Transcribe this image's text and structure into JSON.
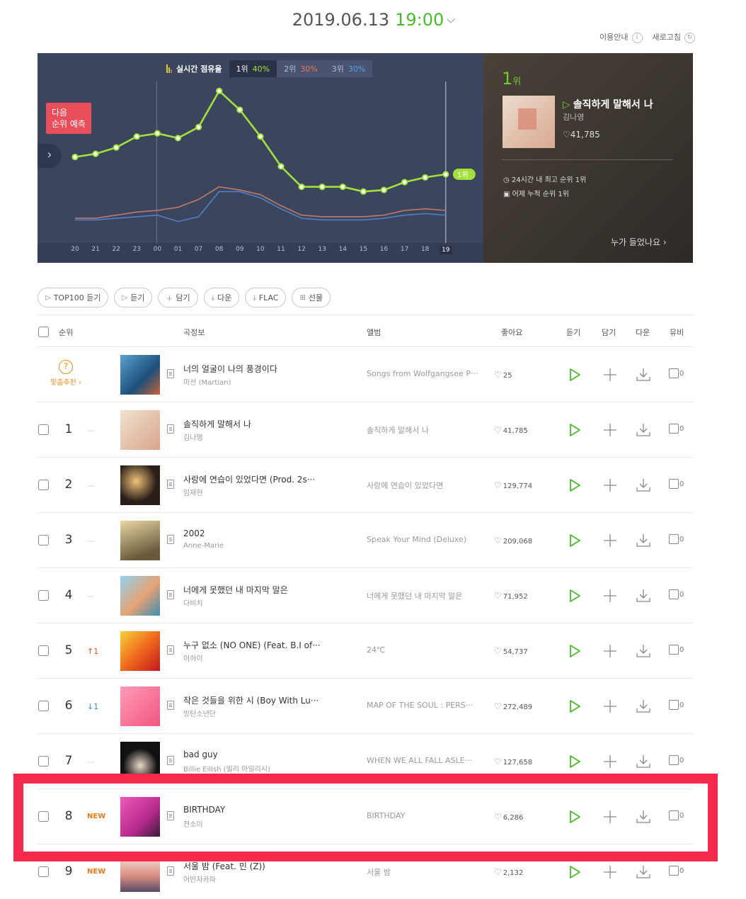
{
  "header": {
    "date": "2019.06.13",
    "time": "19:00",
    "usage_guide": "이용안내",
    "refresh": "새로고침"
  },
  "chart_panel": {
    "title": "실시간 점유율",
    "ranks": [
      {
        "label": "1위",
        "pct": "40%",
        "color": "#9be33a"
      },
      {
        "label": "2위",
        "pct": "30%",
        "color": "#f07a5a"
      },
      {
        "label": "3위",
        "pct": "30%",
        "color": "#4aa6e8"
      }
    ],
    "predict_line1": "다음",
    "predict_line2": "순위 예측",
    "end_badge": "1위",
    "x_labels": [
      "20",
      "21",
      "22",
      "23",
      "00",
      "01",
      "07",
      "08",
      "09",
      "10",
      "11",
      "12",
      "13",
      "14",
      "15",
      "16",
      "17",
      "18",
      "19"
    ]
  },
  "chart_data": {
    "type": "line",
    "x": [
      "20",
      "21",
      "22",
      "23",
      "00",
      "01",
      "07",
      "08",
      "09",
      "10",
      "11",
      "12",
      "13",
      "14",
      "15",
      "16",
      "17",
      "18",
      "19"
    ],
    "series": [
      {
        "name": "1위",
        "color": "#a3e03b",
        "values": [
          52,
          54,
          58,
          65,
          67,
          64,
          71,
          94,
          82,
          65,
          46,
          33,
          33,
          33,
          30,
          31,
          36,
          39,
          41
        ]
      },
      {
        "name": "2위",
        "color": "#c27868",
        "values": [
          13,
          13,
          15,
          17,
          18,
          20,
          25,
          33,
          31,
          28,
          21,
          15,
          14,
          14,
          14,
          15,
          18,
          19,
          18
        ]
      },
      {
        "name": "3위",
        "color": "#4e80c4",
        "values": [
          12,
          12,
          13,
          14,
          15,
          11,
          14,
          30,
          30,
          26,
          19,
          13,
          12,
          12,
          12,
          13,
          15,
          16,
          15
        ]
      }
    ],
    "ylim": [
      0,
      100
    ]
  },
  "top_song": {
    "rank": "1",
    "rank_suffix": "위",
    "title": "솔직하게 말해서 나",
    "artist": "김나영",
    "likes": "41,785",
    "best24": "24시간 내 최고 순위 1위",
    "yesterday": "어제 누적 순위 1위",
    "who_listened": "누가 들었나요 ›"
  },
  "toolbar": [
    "TOP100 듣기",
    "듣기",
    "담기",
    "다운",
    "FLAC",
    "선물"
  ],
  "columns": {
    "rank": "순위",
    "song": "곡정보",
    "album": "앨범",
    "like": "좋아요",
    "listen": "듣기",
    "add": "담기",
    "down": "다운",
    "mv": "뮤비"
  },
  "recommend": {
    "label": "맞춤추천 ›"
  },
  "rows": [
    {
      "rank": "",
      "change": "",
      "title": "너의 얼굴이 나의 풍경이다",
      "artist": "마션 (Martian)",
      "album": "Songs from Wolfgangsee P···",
      "likes": "25",
      "mv": "0"
    },
    {
      "rank": "1",
      "change": "—",
      "title": "솔직하게 말해서 나",
      "artist": "김나영",
      "album": "솔직하게 말해서 나",
      "likes": "41,785",
      "mv": "0"
    },
    {
      "rank": "2",
      "change": "—",
      "title": "사랑에 연습이 있었다면 (Prod. 2s···",
      "artist": "임재현",
      "album": "사랑에 연습이 있었다면",
      "likes": "129,774",
      "mv": "0"
    },
    {
      "rank": "3",
      "change": "—",
      "title": "2002",
      "artist": "Anne-Marie",
      "album": "Speak Your Mind (Deluxe)",
      "likes": "209,068",
      "mv": "0"
    },
    {
      "rank": "4",
      "change": "—",
      "title": "너에게 못했던 내 마지막 말은",
      "artist": "다비치",
      "album": "너에게 못했던 내 마지막 말은",
      "likes": "71,952",
      "mv": "0"
    },
    {
      "rank": "5",
      "change": "↑1",
      "title": "누구 없소 (NO ONE) (Feat. B.I of···",
      "artist": "이하이",
      "album": "24℃",
      "likes": "54,737",
      "mv": "0"
    },
    {
      "rank": "6",
      "change": "↓1",
      "title": "작은 것들을 위한 시 (Boy With Lu···",
      "artist": "방탄소년단",
      "album": "MAP OF THE SOUL : PERS···",
      "likes": "272,489",
      "mv": "0"
    },
    {
      "rank": "7",
      "change": "—",
      "title": "bad guy",
      "artist": "Billie Eilish (빌리 아일리시)",
      "album": "WHEN WE ALL FALL ASLE···",
      "likes": "127,658",
      "mv": "0"
    },
    {
      "rank": "8",
      "change": "NEW",
      "title": "BIRTHDAY",
      "artist": "전소미",
      "album": "BIRTHDAY",
      "likes": "6,286",
      "mv": "0"
    },
    {
      "rank": "9",
      "change": "NEW",
      "title": "서울 밤 (Feat. 민 (Z))",
      "artist": "어반자카파",
      "album": "서울 밤",
      "likes": "2,132",
      "mv": "0"
    }
  ],
  "colors": {
    "accent": "#4bbb2c",
    "highlight": "#f5294c",
    "panel": "#3b465e"
  }
}
